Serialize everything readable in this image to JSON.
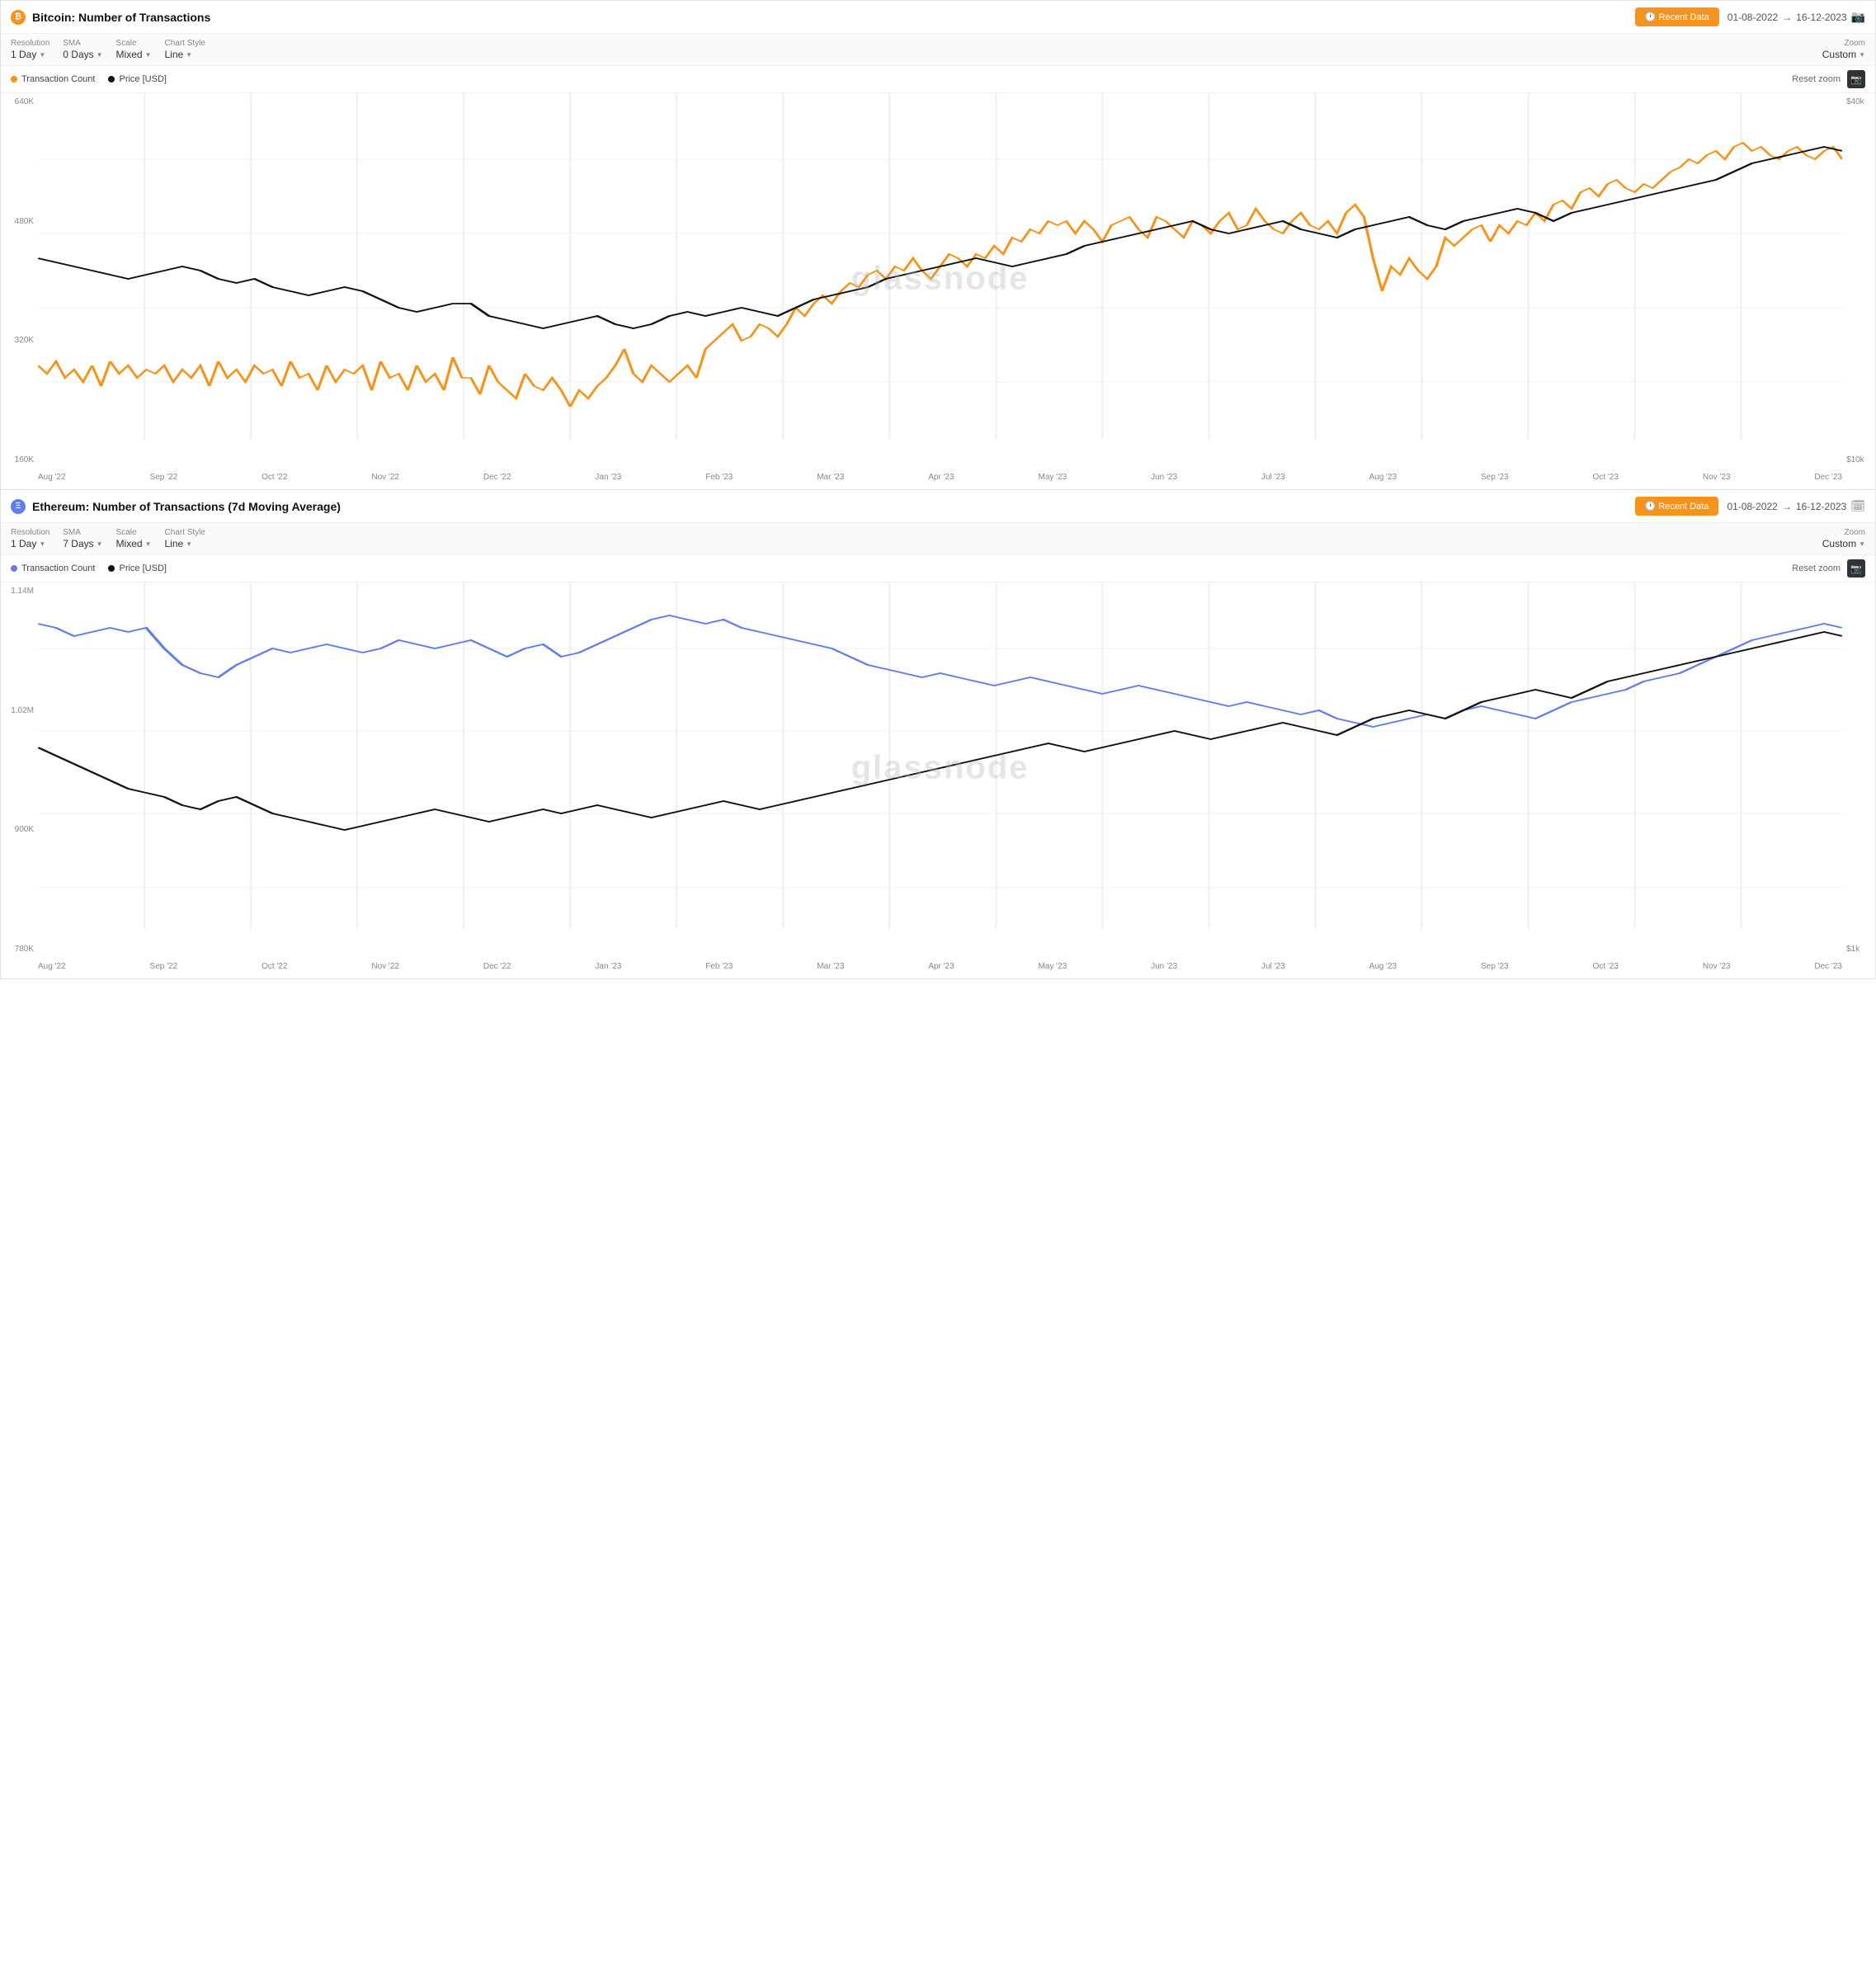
{
  "chart1": {
    "title": "Bitcoin: Number of Transactions",
    "icon": "₿",
    "icon_class": "btc-icon",
    "recent_data_label": "🕐 Recent Data",
    "date_from": "01-08-2022",
    "date_arrow": "→",
    "date_to": "16-12-2023",
    "resolution_label": "Resolution",
    "resolution_value": "1 Day",
    "sma_label": "SMA",
    "sma_value": "0 Days",
    "scale_label": "Scale",
    "scale_value": "Mixed",
    "chart_style_label": "Chart Style",
    "chart_style_value": "Line",
    "zoom_label": "Zoom",
    "zoom_value": "Custom",
    "legend_transaction": "Transaction Count",
    "legend_price": "Price [USD]",
    "reset_zoom": "Reset zoom",
    "y_left": [
      "640K",
      "480K",
      "320K",
      "160K"
    ],
    "y_right": [
      "$40k",
      "$10k"
    ],
    "x_labels": [
      "Aug '22",
      "Sep '22",
      "Oct '22",
      "Nov '22",
      "Dec '22",
      "Jan '23",
      "Feb '23",
      "Mar '23",
      "Apr '23",
      "May '23",
      "Jun '23",
      "Jul '23",
      "Aug '23",
      "Sep '23",
      "Oct '23",
      "Nov '23",
      "Dec '23"
    ],
    "watermark": "glassnode"
  },
  "chart2": {
    "title": "Ethereum: Number of Transactions (7d Moving Average)",
    "icon": "Ξ",
    "icon_class": "eth-icon",
    "recent_data_label": "🕐 Recent Data",
    "date_from": "01-08-2022",
    "date_arrow": "→",
    "date_to": "16-12-2023",
    "resolution_label": "Resolution",
    "resolution_value": "1 Day",
    "sma_label": "SMA",
    "sma_value": "7 Days",
    "scale_label": "Scale",
    "scale_value": "Mixed",
    "chart_style_label": "Chart Style",
    "chart_style_value": "Line",
    "zoom_label": "Zoom",
    "zoom_value": "Custom",
    "legend_transaction": "Transaction Count",
    "legend_price": "Price [USD]",
    "reset_zoom": "Reset zoom",
    "y_left": [
      "1.14M",
      "1.02M",
      "900K",
      "780K"
    ],
    "y_right": [
      "$1k"
    ],
    "x_labels": [
      "Aug '22",
      "Sep '22",
      "Oct '22",
      "Nov '22",
      "Dec '22",
      "Jan '23",
      "Feb '23",
      "Mar '23",
      "Apr '23",
      "May '23",
      "Jun '23",
      "Jul '23",
      "Aug '23",
      "Sep '23",
      "Oct '23",
      "Nov '23",
      "Dec '23"
    ],
    "watermark": "glassnode"
  }
}
